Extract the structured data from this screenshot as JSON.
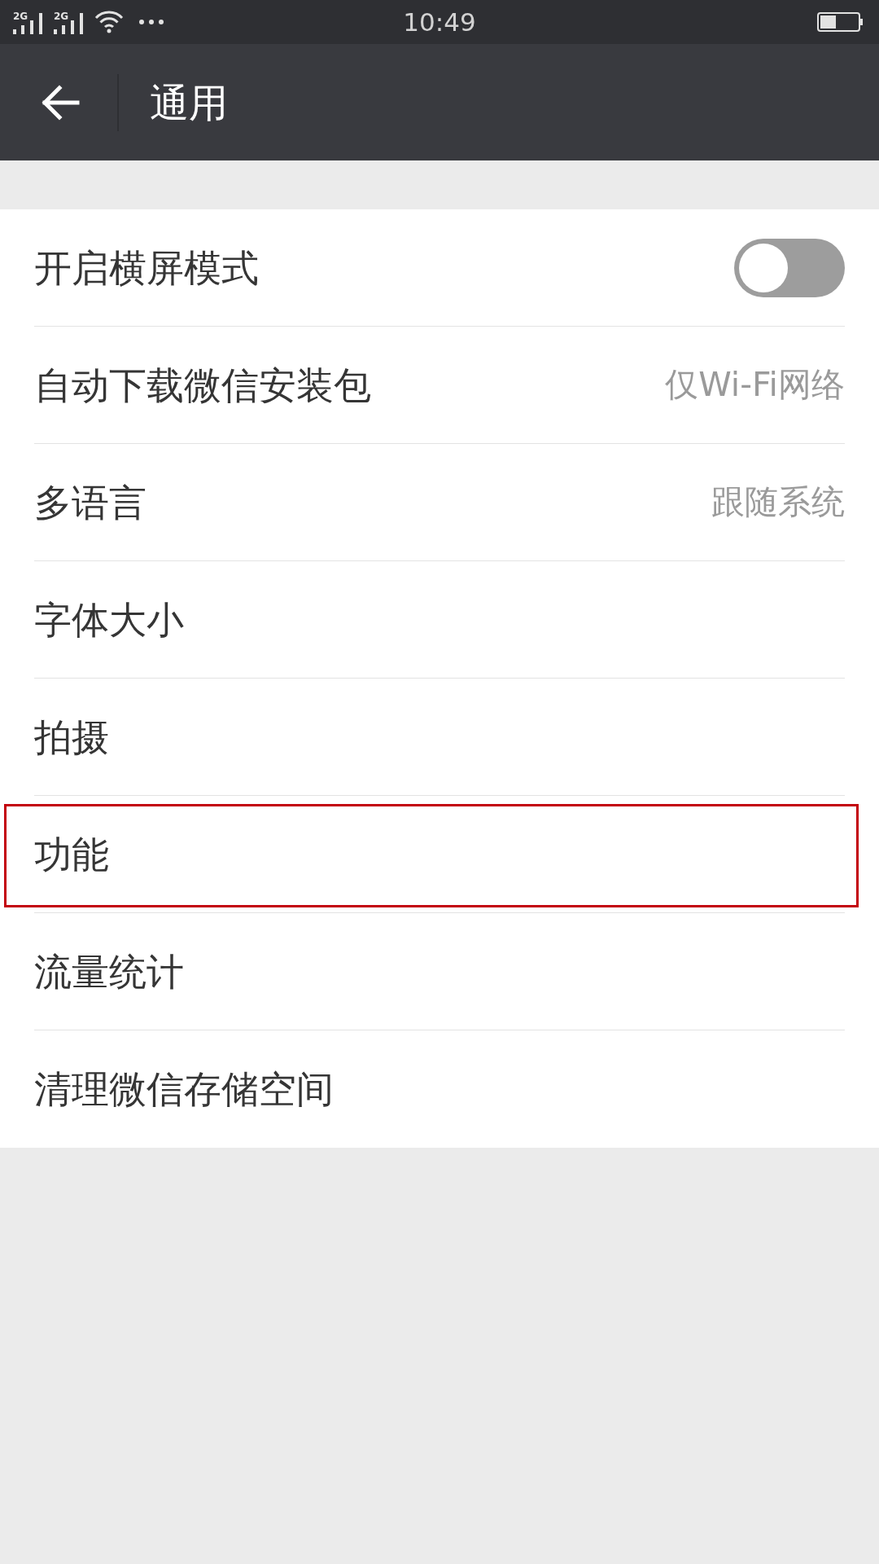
{
  "status_bar": {
    "signals": [
      {
        "label": "2G"
      },
      {
        "label": "2G"
      }
    ],
    "time": "10:49"
  },
  "header": {
    "title": "通用"
  },
  "settings": [
    {
      "kind": "toggle",
      "label": "开启横屏模式",
      "on": false,
      "highlighted": false
    },
    {
      "kind": "value",
      "label": "自动下载微信安装包",
      "value": "仅Wi-Fi网络",
      "highlighted": false
    },
    {
      "kind": "value",
      "label": "多语言",
      "value": "跟随系统",
      "highlighted": false
    },
    {
      "kind": "plain",
      "label": "字体大小",
      "highlighted": false
    },
    {
      "kind": "plain",
      "label": "拍摄",
      "highlighted": false
    },
    {
      "kind": "plain",
      "label": "功能",
      "highlighted": true
    },
    {
      "kind": "plain",
      "label": "流量统计",
      "highlighted": false
    },
    {
      "kind": "plain",
      "label": "清理微信存储空间",
      "highlighted": false
    }
  ]
}
